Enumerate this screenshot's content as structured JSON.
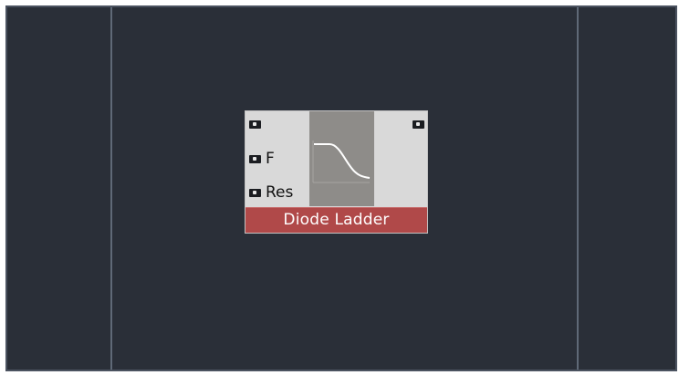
{
  "module": {
    "title": "Diode Ladder",
    "inputs": [
      {
        "label": ""
      },
      {
        "label": "F"
      },
      {
        "label": "Res"
      }
    ],
    "outputs": [
      {
        "label": ""
      }
    ],
    "display_icon": "lowpass-curve-icon",
    "colors": {
      "background": "#2a2f38",
      "module_body": "#d9d9d9",
      "title_bar": "#b04949",
      "display": "#8e8c89"
    }
  }
}
